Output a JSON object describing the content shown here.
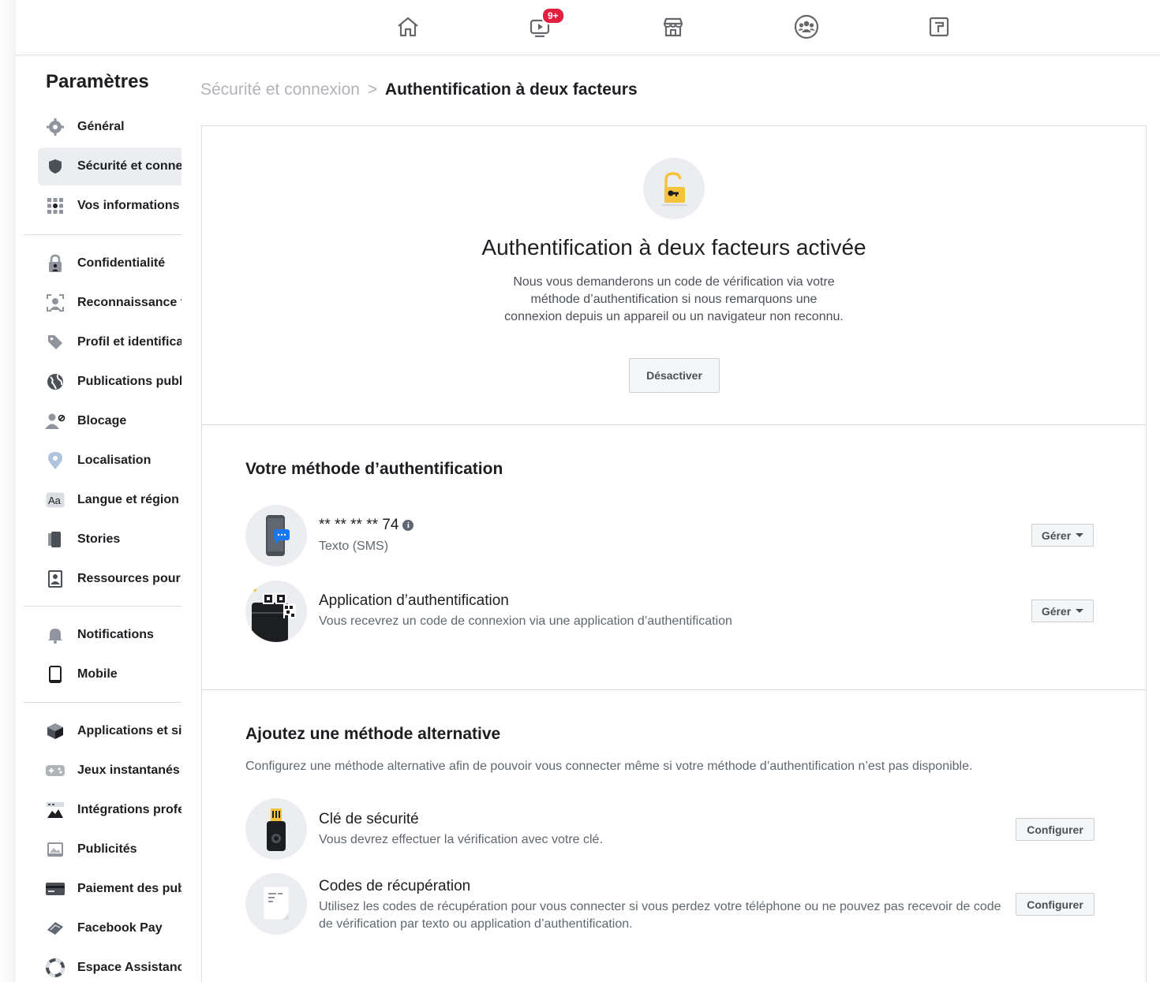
{
  "topnav": {
    "video_badge": "9+"
  },
  "sidebar": {
    "title": "Paramètres",
    "items": [
      {
        "label": "Général",
        "icon": "gear-icon",
        "active": false
      },
      {
        "label": "Sécurité et connexion",
        "icon": "shield-icon",
        "active": true
      },
      {
        "label": "Vos informations Facebook",
        "icon": "grid-info-icon",
        "active": false
      },
      {
        "label": "Confidentialité",
        "icon": "lock-person-icon",
        "active": false
      },
      {
        "label": "Reconnaissance faciale",
        "icon": "face-recognition-icon",
        "active": false
      },
      {
        "label": "Profil et identification",
        "icon": "tag-icon",
        "active": false
      },
      {
        "label": "Publications publiques",
        "icon": "globe-icon",
        "active": false
      },
      {
        "label": "Blocage",
        "icon": "block-user-icon",
        "active": false
      },
      {
        "label": "Localisation",
        "icon": "location-pin-icon",
        "active": false
      },
      {
        "label": "Langue et région",
        "icon": "language-icon",
        "active": false
      },
      {
        "label": "Stories",
        "icon": "stories-icon",
        "active": false
      },
      {
        "label": "Ressources pour les journalistes",
        "icon": "id-badge-icon",
        "active": false
      },
      {
        "label": "Notifications",
        "icon": "bell-icon",
        "active": false
      },
      {
        "label": "Mobile",
        "icon": "phone-icon",
        "active": false
      },
      {
        "label": "Applications et sites web",
        "icon": "cube-icon",
        "active": false
      },
      {
        "label": "Jeux instantanés",
        "icon": "gamepad-icon",
        "active": false
      },
      {
        "label": "Intégrations professionnelles",
        "icon": "business-integration-icon",
        "active": false
      },
      {
        "label": "Publicités",
        "icon": "ads-icon",
        "active": false
      },
      {
        "label": "Paiement des publicités",
        "icon": "credit-card-icon",
        "active": false
      },
      {
        "label": "Facebook Pay",
        "icon": "facebook-pay-icon",
        "active": false
      },
      {
        "label": "Espace Assistance",
        "icon": "lifebuoy-icon",
        "active": false
      }
    ]
  },
  "breadcrumb": {
    "parent": "Sécurité et connexion",
    "separator": ">",
    "current": "Authentification à deux facteurs"
  },
  "hero": {
    "title": "Authentification à deux facteurs activée",
    "description": "Nous vous demanderons un code de vérification via votre méthode d’authentification si nous remarquons une connexion depuis un appareil ou un navigateur non reconnu.",
    "button": "Désactiver"
  },
  "auth_method": {
    "title": "Votre méthode d’authentification",
    "methods": [
      {
        "title": "** ** ** ** 74",
        "subtitle": "Texto (SMS)",
        "button": "Gérer",
        "icon": "sms-phone-icon"
      },
      {
        "title": "Application d’authentification",
        "subtitle": "Vous recevrez un code de connexion via une application d’authentification",
        "button": "Gérer",
        "icon": "qr-code-icon"
      }
    ]
  },
  "alternative": {
    "title": "Ajoutez une méthode alternative",
    "description": "Configurez une méthode alternative afin de pouvoir vous connecter même si votre méthode d’authentification n’est pas disponible.",
    "methods": [
      {
        "title": "Clé de sécurité",
        "subtitle": "Vous devrez effectuer la vérification avec votre clé.",
        "button": "Configurer",
        "icon": "security-key-icon"
      },
      {
        "title": "Codes de récupération",
        "subtitle": "Utilisez les codes de récupération pour vous connecter si vous perdez votre téléphone ou ne pouvez pas recevoir de code de vérification par texto ou application d’authentification.",
        "button": "Configurer",
        "icon": "recovery-codes-icon"
      }
    ]
  },
  "colors": {
    "badge": "#e41e3f",
    "lock": "#f5c33b",
    "sms_bubble": "#1877f2"
  }
}
